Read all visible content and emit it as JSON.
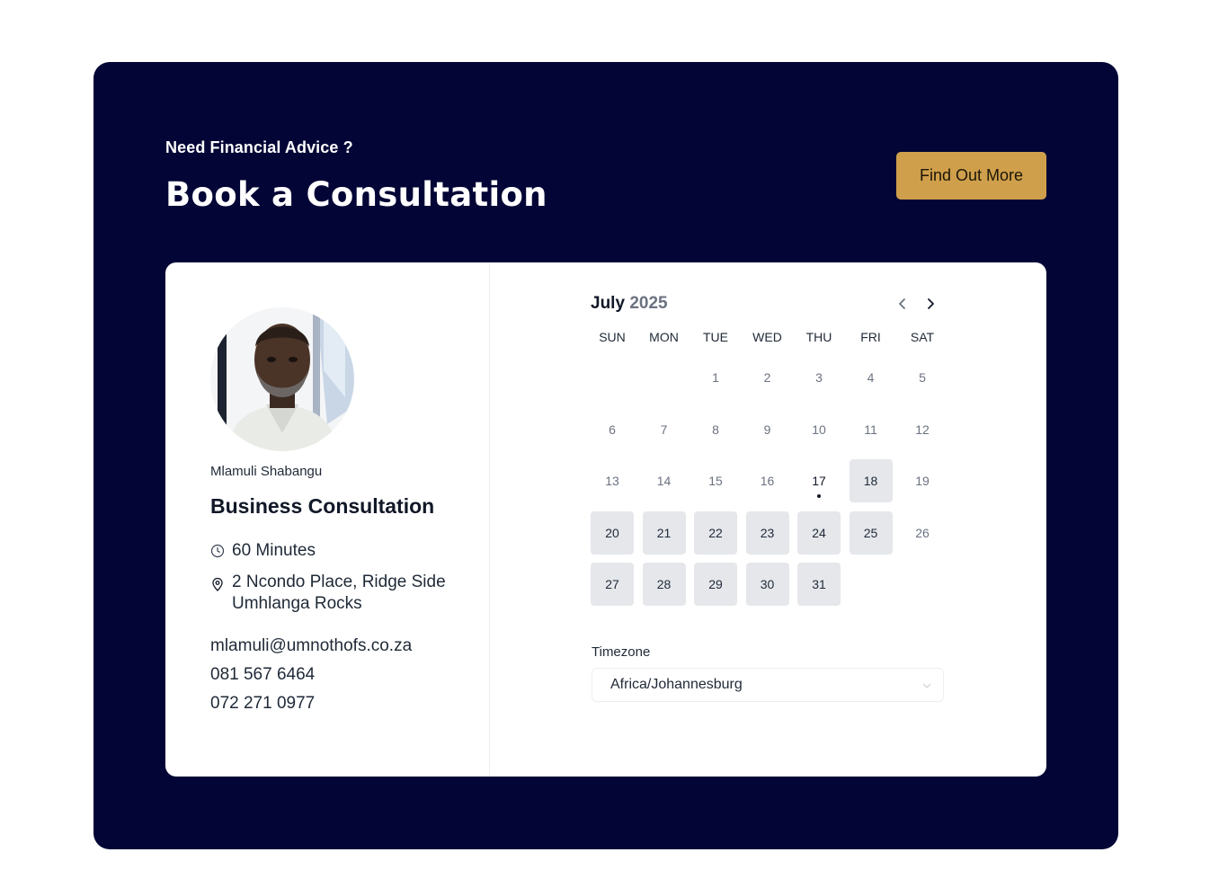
{
  "hero": {
    "kicker": "Need Financial Advice ?",
    "headline": "Book a Consultation",
    "cta_label": "Find Out More",
    "background_color": "#020535",
    "cta_color": "#cf9f4b"
  },
  "profile": {
    "host_name": "Mlamuli Shabangu",
    "event_title": "Business Consultation",
    "duration": "60 Minutes",
    "location": "2 Ncondo Place, Ridge Side Umhlanga Rocks",
    "email": "mlamuli@umnothofs.co.za",
    "phones": [
      "081 567 6464",
      "072 271 0977"
    ],
    "icons": {
      "duration": "clock-icon",
      "location": "map-pin-icon"
    }
  },
  "calendar": {
    "month": "July",
    "year": "2025",
    "weekdays": [
      "SUN",
      "MON",
      "TUE",
      "WED",
      "THU",
      "FRI",
      "SAT"
    ],
    "first_weekday_index": 2,
    "days_in_month": 31,
    "today": 17,
    "available_days": [
      18,
      20,
      21,
      22,
      23,
      24,
      25,
      27,
      28,
      29,
      30,
      31
    ],
    "prev_icon": "chevron-left-icon",
    "next_icon": "chevron-right-icon"
  },
  "timezone": {
    "label": "Timezone",
    "value": "Africa/Johannesburg"
  }
}
